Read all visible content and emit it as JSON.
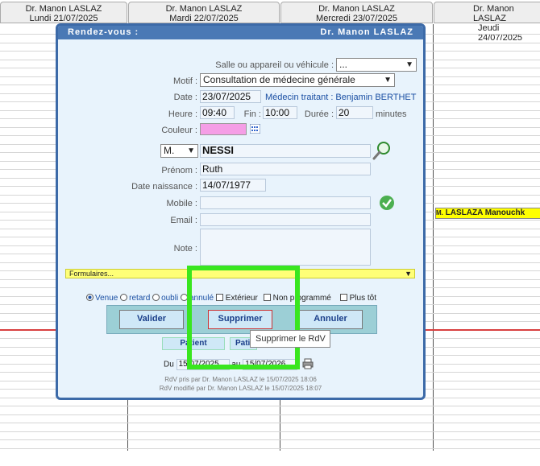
{
  "calendar": {
    "days": [
      {
        "doctor": "Dr. Manon LASLAZ",
        "date": "Lundi 21/07/2025"
      },
      {
        "doctor": "Dr. Manon LASLAZ",
        "date": "Mardi 22/07/2025"
      },
      {
        "doctor": "Dr. Manon LASLAZ",
        "date": "Mercredi 23/07/2025"
      },
      {
        "doctor": "Dr. Manon LASLAZ",
        "date": "Jeudi 24/07/2025"
      }
    ],
    "event": {
      "prefix": "M.",
      "name": "LASLAZA Manouchk"
    }
  },
  "dialog": {
    "title": "Rendez-vous :",
    "doctor": "Dr. Manon LASLAZ",
    "room_label": "Salle ou appareil ou véhicule :",
    "room_value": "...",
    "motif_label": "Motif :",
    "motif_value": "Consultation de médecine générale",
    "date_label": "Date :",
    "date_value": "23/07/2025",
    "medecin_traitant": "Médecin traitant : Benjamin BERTHET",
    "heure_label": "Heure :",
    "heure_value": "09:40",
    "fin_label": "Fin :",
    "fin_value": "10:00",
    "duree_label": "Durée :",
    "duree_value": "20",
    "minutes": "minutes",
    "couleur_label": "Couleur :",
    "civility": "M.",
    "nom": "NESSI",
    "prenom_label": "Prénom :",
    "prenom": "Ruth",
    "naissance_label": "Date naissance :",
    "naissance": "14/07/1977",
    "mobile_label": "Mobile :",
    "mobile": "",
    "email_label": "Email :",
    "email": "",
    "note_label": "Note :",
    "note": "",
    "formulaires": "Formulaires...",
    "status": {
      "venue": "Venue",
      "retard": "retard",
      "oubli": "oubli",
      "annule": "annulé",
      "exterieur": "Extérieur",
      "non_programme": "Non programmé",
      "plus_tot": "Plus tôt"
    },
    "buttons": {
      "valider": "Valider",
      "supprimer": "Supprimer",
      "annuler": "Annuler"
    },
    "patient_btn": "Patient",
    "patient_btn2": "Pati",
    "du_label": "Du",
    "du_value": "15/07/2025",
    "au_label": "au",
    "au_value": "15/07/2026",
    "rdv_pris": "RdV pris par Dr. Manon LASLAZ le 15/07/2025 18:06",
    "rdv_modifie": "RdV modifié par Dr. Manon LASLAZ le 15/07/2025 18:07"
  },
  "tooltip": "Supprimer le RdV",
  "colors": {
    "accent": "#4a79b5",
    "highlight": "#39e61f",
    "couleur_swatch": "#f59ee6"
  }
}
